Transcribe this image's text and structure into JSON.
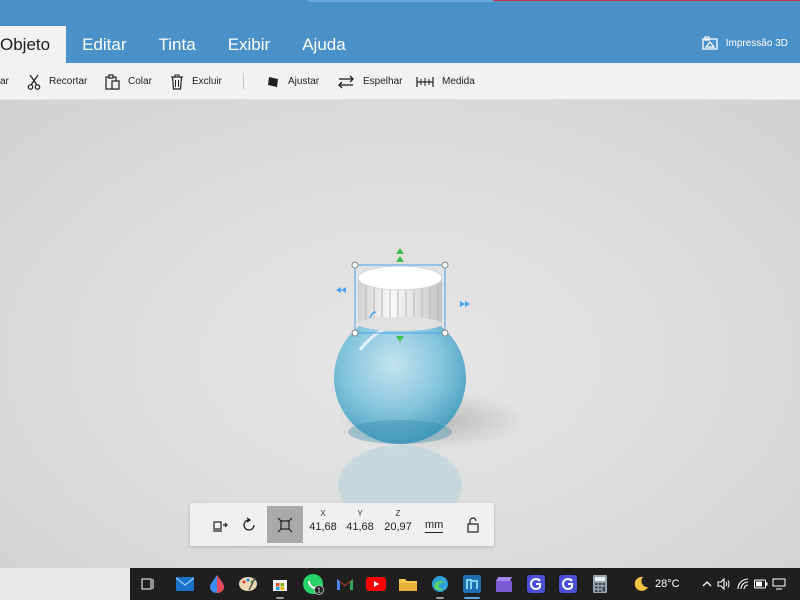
{
  "menu": {
    "tabs": [
      {
        "label": "Objeto",
        "active": true
      },
      {
        "label": "Editar"
      },
      {
        "label": "Tinta"
      },
      {
        "label": "Exibir"
      },
      {
        "label": "Ajuda"
      }
    ],
    "print3d_label": "Impressão 3D"
  },
  "toolbar": {
    "partial_label": "ar",
    "cut_label": "Recortar",
    "paste_label": "Colar",
    "delete_label": "Excluir",
    "fit_label": "Ajustar",
    "mirror_label": "Espelhar",
    "measure_label": "Medida"
  },
  "transform_panel": {
    "x_label": "X",
    "x_value": "41,68",
    "y_label": "Y",
    "y_value": "41,68",
    "z_label": "Z",
    "z_value": "20,97",
    "unit": "mm"
  },
  "taskbar": {
    "temperature": "28°C",
    "whatsapp_badge": "1",
    "apps": [
      "task-view",
      "mail",
      "drop",
      "paint",
      "store",
      "whatsapp",
      "gmail",
      "youtube",
      "files",
      "edge",
      "app-n",
      "clipchamp",
      "app-g1",
      "app-g2",
      "calculator"
    ]
  },
  "colors": {
    "menubar": "#4a90c9",
    "toolbar": "#f2f2f2",
    "canvas": "#dadada",
    "selection": "#4aa3f0",
    "gizmo_green": "#3fbf4f",
    "taskbar": "#1f1f1f"
  }
}
